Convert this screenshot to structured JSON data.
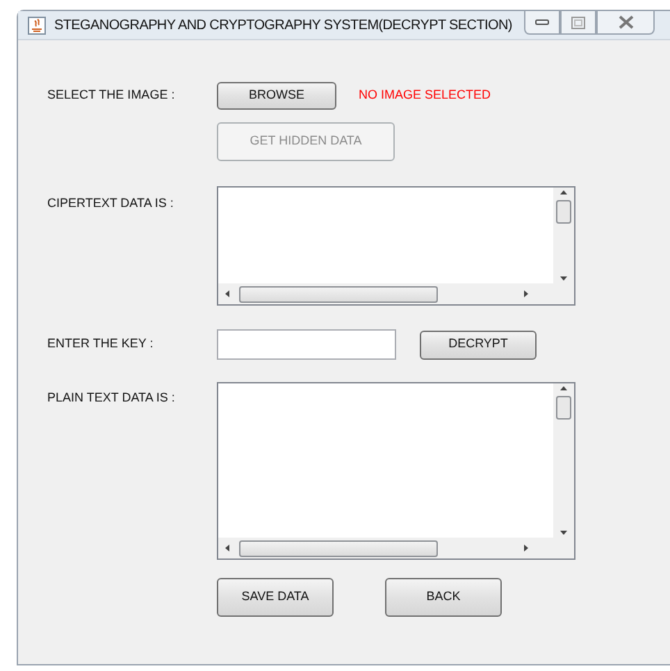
{
  "window": {
    "title": "STEGANOGRAPHY AND CRYPTOGRAPHY SYSTEM(DECRYPT SECTION)"
  },
  "image_row": {
    "label": "SELECT THE IMAGE :",
    "button": "BROWSE",
    "status": {
      "text": "NO IMAGE SELECTED",
      "kind": "error"
    }
  },
  "get_hidden_button": {
    "label": "GET HIDDEN DATA",
    "disabled": true
  },
  "ciphertext": {
    "label": "CIPERTEXT DATA IS :"
  },
  "key_row": {
    "label": "ENTER THE KEY :",
    "button": "DECRYPT"
  },
  "plaintext": {
    "label": "PLAIN TEXT DATA IS :"
  },
  "buttons": [
    {
      "label": "SAVE DATA"
    },
    {
      "label": "BACK"
    }
  ]
}
